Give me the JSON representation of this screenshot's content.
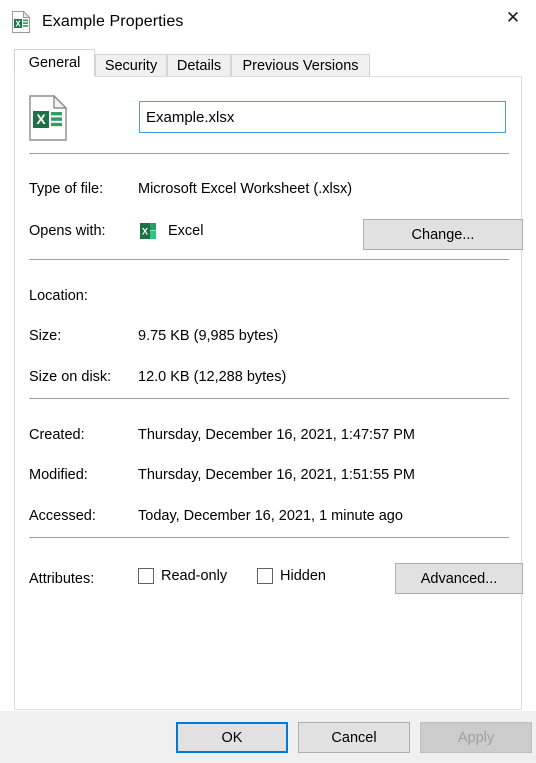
{
  "window": {
    "title": "Example Properties",
    "icon": "excel-file-icon",
    "close_label": "✕"
  },
  "tabs": [
    {
      "label": "General",
      "active": true
    },
    {
      "label": "Security",
      "active": false
    },
    {
      "label": "Details",
      "active": false
    },
    {
      "label": "Previous Versions",
      "active": false
    }
  ],
  "general": {
    "filename_value": "Example.xlsx",
    "rows": [
      {
        "label": "Type of file:",
        "value": "Microsoft Excel Worksheet (.xlsx)"
      },
      {
        "label": "Opens with:",
        "value": "Excel"
      },
      {
        "label": "Location:",
        "value": ""
      },
      {
        "label": "Size:",
        "value": "9.75 KB (9,985 bytes)"
      },
      {
        "label": "Size on disk:",
        "value": "12.0 KB (12,288 bytes)"
      },
      {
        "label": "Created:",
        "value": "Thursday, December 16, 2021, 1:47:57 PM"
      },
      {
        "label": "Modified:",
        "value": "Thursday, December 16, 2021, 1:51:55 PM"
      },
      {
        "label": "Accessed:",
        "value": "Today, December 16, 2021, 1 minute ago"
      },
      {
        "label": "Attributes:",
        "value": ""
      }
    ],
    "change_button": "Change...",
    "advanced_button": "Advanced...",
    "checkboxes": [
      {
        "label": "Read-only",
        "checked": false
      },
      {
        "label": "Hidden",
        "checked": false
      }
    ]
  },
  "footer": {
    "ok": "OK",
    "cancel": "Cancel",
    "apply": "Apply",
    "apply_disabled": true
  },
  "colors": {
    "accent": "#0078d7",
    "field_border": "#4a9ed4",
    "excel_green": "#1e7145",
    "excel_green_light": "#21a366",
    "footer_bg": "#f0f0f0",
    "separator": "#a0a0a4"
  }
}
